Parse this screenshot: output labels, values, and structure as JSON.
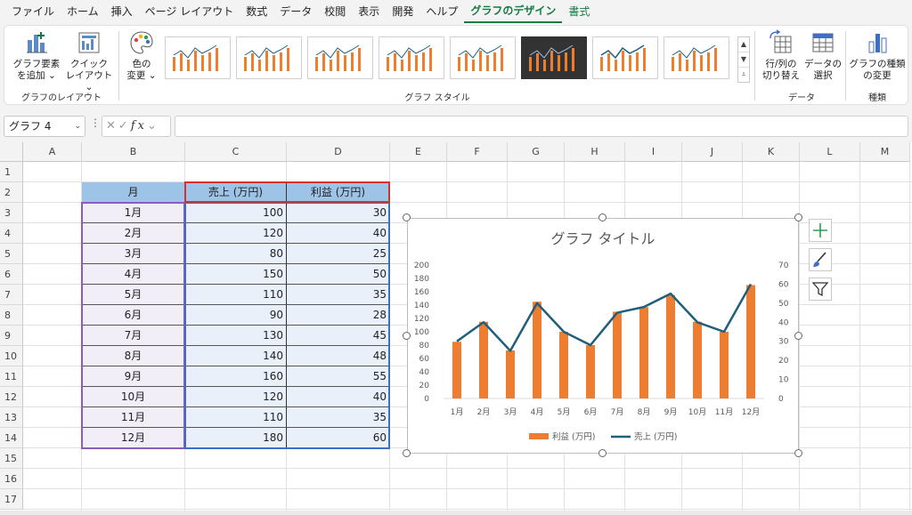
{
  "menu": {
    "items": [
      "ファイル",
      "ホーム",
      "挿入",
      "ページ レイアウト",
      "数式",
      "データ",
      "校閲",
      "表示",
      "開発",
      "ヘルプ",
      "グラフのデザイン",
      "書式"
    ],
    "active_index": 10
  },
  "ribbon": {
    "add_element": {
      "line1": "グラフ要素",
      "line2": "を追加 ⌄"
    },
    "quick_layout": {
      "line1": "クイック",
      "line2": "レイアウト ⌄"
    },
    "layout_group_label": "グラフのレイアウト",
    "change_colors": {
      "line1": "色の",
      "line2": "変更 ⌄"
    },
    "style_group_label": "グラフ スタイル",
    "switch_row_col": {
      "line1": "行/列の",
      "line2": "切り替え"
    },
    "select_data": {
      "line1": "データの",
      "line2": "選択"
    },
    "data_group_label": "データ",
    "change_type": {
      "line1": "グラフの種類",
      "line2": "の変更"
    },
    "type_group_label": "種類"
  },
  "formula_bar": {
    "name_box": "グラフ 4",
    "fx_symbol": "fx",
    "value": ""
  },
  "grid": {
    "columns": [
      "A",
      "B",
      "C",
      "D",
      "E",
      "F",
      "G",
      "H",
      "I",
      "J",
      "K",
      "L",
      "M"
    ],
    "rows": [
      "1",
      "2",
      "3",
      "4",
      "5",
      "6",
      "7",
      "8",
      "9",
      "10",
      "11",
      "12",
      "13",
      "14",
      "15",
      "16",
      "17"
    ],
    "table_headers": [
      "月",
      "売上 (万円)",
      "利益 (万円)"
    ],
    "table_rows": [
      [
        "1月",
        "100",
        "30"
      ],
      [
        "2月",
        "120",
        "40"
      ],
      [
        "3月",
        "80",
        "25"
      ],
      [
        "4月",
        "150",
        "50"
      ],
      [
        "5月",
        "110",
        "35"
      ],
      [
        "6月",
        "90",
        "28"
      ],
      [
        "7月",
        "130",
        "45"
      ],
      [
        "8月",
        "140",
        "48"
      ],
      [
        "9月",
        "160",
        "55"
      ],
      [
        "10月",
        "120",
        "40"
      ],
      [
        "11月",
        "110",
        "35"
      ],
      [
        "12月",
        "180",
        "60"
      ]
    ]
  },
  "chart_data": {
    "type": "bar",
    "title": "グラフ タイトル",
    "categories": [
      "1月",
      "2月",
      "3月",
      "4月",
      "5月",
      "6月",
      "7月",
      "8月",
      "9月",
      "10月",
      "11月",
      "12月"
    ],
    "series": [
      {
        "name": "利益 (万円)",
        "type": "bar",
        "axis": "left",
        "values": [
          85,
          115,
          72,
          145,
          100,
          80,
          130,
          137,
          155,
          115,
          100,
          170
        ],
        "color": "#ed7d31"
      },
      {
        "name": "売上 (万円)",
        "type": "line",
        "axis": "right",
        "values": [
          30,
          40,
          25,
          50,
          35,
          28,
          45,
          48,
          55,
          40,
          35,
          60
        ],
        "color": "#1f5f7a"
      }
    ],
    "y_left": {
      "min": 0,
      "max": 200,
      "step": 20
    },
    "y_right": {
      "min": 0,
      "max": 70,
      "step": 10
    },
    "legend": "bottom",
    "grid": false
  },
  "chart_side_buttons": {
    "elements_icon": "plus-icon",
    "styles_icon": "brush-icon",
    "filter_icon": "filter-icon"
  },
  "colors": {
    "accent_green": "#107c41",
    "header_blue": "#9dc3e6",
    "bar_orange": "#ed7d31",
    "line_blue": "#1f5f7a"
  }
}
